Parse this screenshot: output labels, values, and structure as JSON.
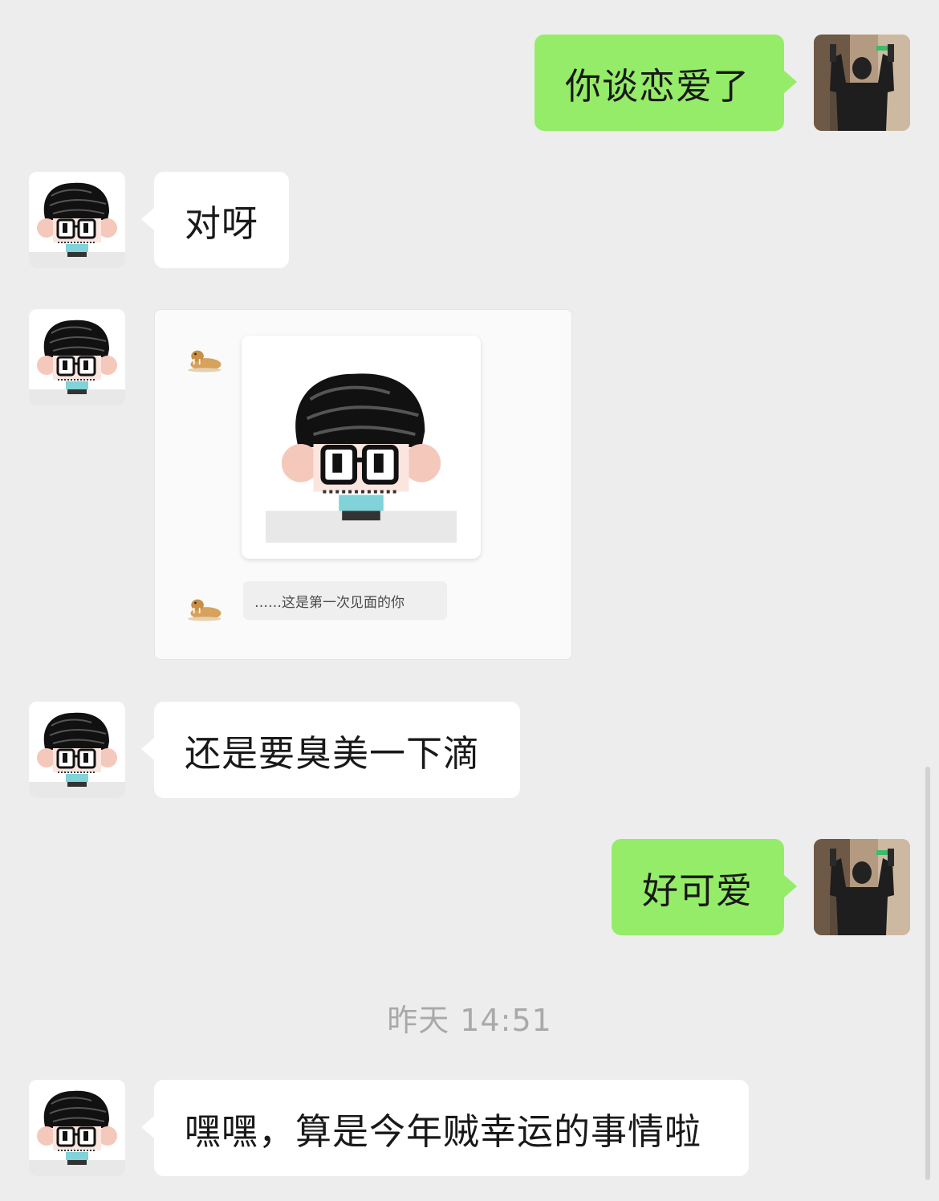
{
  "chat": {
    "messages": [
      {
        "side": "right",
        "type": "text",
        "text": "你谈恋爱了"
      },
      {
        "side": "left",
        "type": "text",
        "text": "对呀"
      },
      {
        "side": "left",
        "type": "image",
        "caption": "……这是第一次见面的你"
      },
      {
        "side": "left",
        "type": "text",
        "text": "还是要臭美一下滴"
      },
      {
        "side": "right",
        "type": "text",
        "text": "好可爱"
      },
      {
        "side": "left",
        "type": "text",
        "text": "嘿嘿，算是今年贼幸运的事情啦"
      }
    ],
    "timestamp": "昨天 14:51"
  },
  "colors": {
    "background": "#ededed",
    "incoming_bubble": "#ffffff",
    "outgoing_bubble": "#95ec69",
    "timestamp_text": "#a9a9a9"
  },
  "icons": {
    "self_avatar": "person-photo-avatar",
    "contact_avatar": "cartoon-glasses-avatar",
    "sticker_icon": "walrus-sticker-icon"
  }
}
